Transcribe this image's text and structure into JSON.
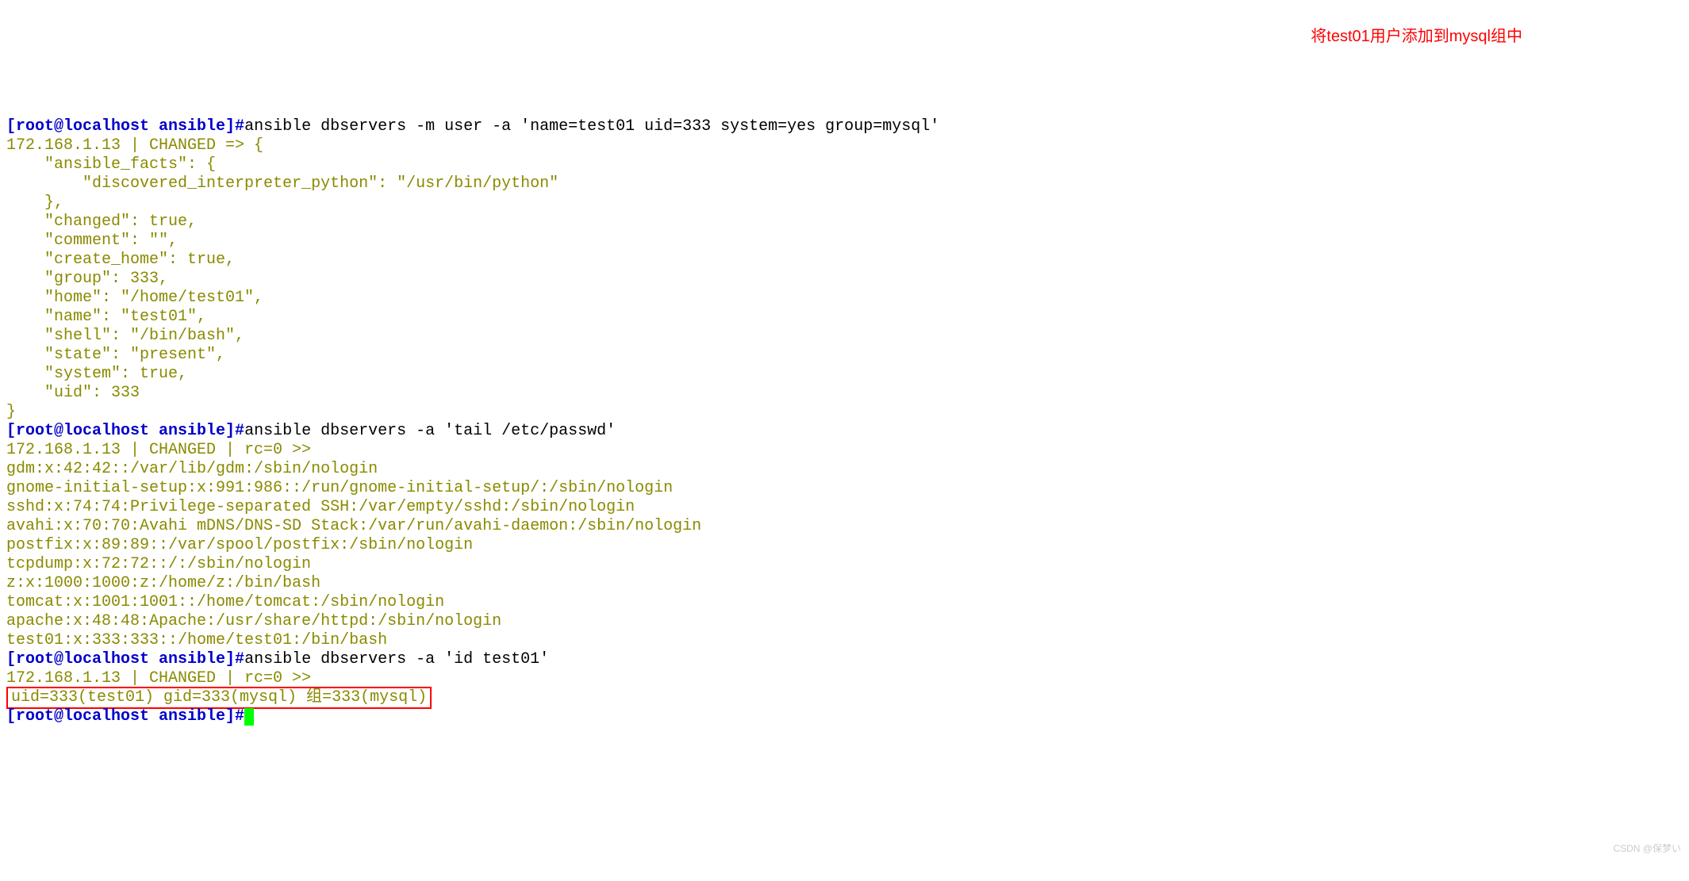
{
  "annotation": "将test01用户添加到mysql组中",
  "prompt1_prefix": "[root@localhost ansible]#",
  "cmd1": "ansible dbservers -m user -a 'name=test01 uid=333 system=yes group=mysql'",
  "out1_header": "172.168.1.13 | CHANGED => {",
  "out1_l1": "    \"ansible_facts\": {",
  "out1_l2": "        \"discovered_interpreter_python\": \"/usr/bin/python\"",
  "out1_l3": "    },",
  "out1_l4": "    \"changed\": true,",
  "out1_l5": "    \"comment\": \"\",",
  "out1_l6": "    \"create_home\": true,",
  "out1_l7": "    \"group\": 333,",
  "out1_l8": "    \"home\": \"/home/test01\",",
  "out1_l9": "    \"name\": \"test01\",",
  "out1_l10": "    \"shell\": \"/bin/bash\",",
  "out1_l11": "    \"state\": \"present\",",
  "out1_l12": "    \"system\": true,",
  "out1_l13": "    \"uid\": 333",
  "out1_l14": "}",
  "prompt2_prefix": "[root@localhost ansible]#",
  "cmd2": "ansible dbservers -a 'tail /etc/passwd'",
  "out2_header": "172.168.1.13 | CHANGED | rc=0 >>",
  "out2_l1": "gdm:x:42:42::/var/lib/gdm:/sbin/nologin",
  "out2_l2": "gnome-initial-setup:x:991:986::/run/gnome-initial-setup/:/sbin/nologin",
  "out2_l3": "sshd:x:74:74:Privilege-separated SSH:/var/empty/sshd:/sbin/nologin",
  "out2_l4": "avahi:x:70:70:Avahi mDNS/DNS-SD Stack:/var/run/avahi-daemon:/sbin/nologin",
  "out2_l5": "postfix:x:89:89::/var/spool/postfix:/sbin/nologin",
  "out2_l6": "tcpdump:x:72:72::/:/sbin/nologin",
  "out2_l7": "z:x:1000:1000:z:/home/z:/bin/bash",
  "out2_l8": "tomcat:x:1001:1001::/home/tomcat:/sbin/nologin",
  "out2_l9": "apache:x:48:48:Apache:/usr/share/httpd:/sbin/nologin",
  "out2_l10": "test01:x:333:333::/home/test01:/bin/bash",
  "prompt3_prefix": "[root@localhost ansible]#",
  "cmd3": "ansible dbservers -a 'id test01'",
  "out3_header": "172.168.1.13 | CHANGED | rc=0 >>",
  "out3_boxed": "uid=333(test01) gid=333(mysql) 组=333(mysql)",
  "prompt4_prefix": "[root@localhost ansible]#",
  "watermark": "CSDN @保梦い"
}
